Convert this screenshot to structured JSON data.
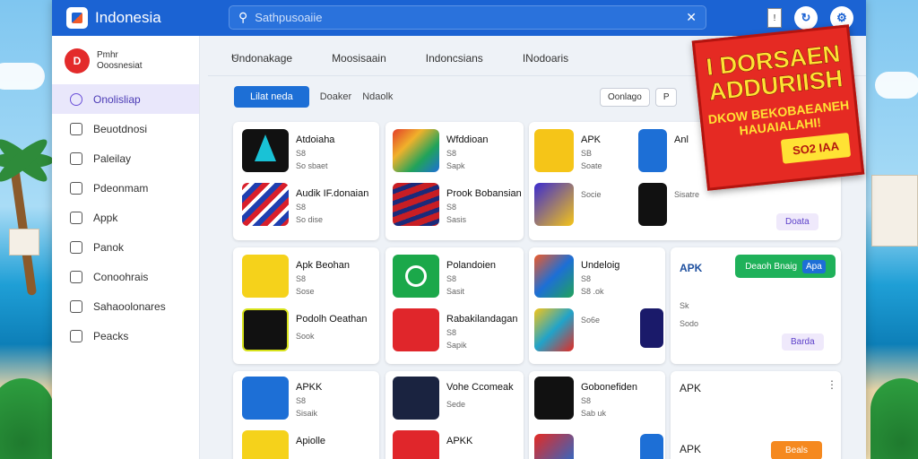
{
  "window": {
    "title": "Indonesia"
  },
  "search": {
    "placeholder": "Sathpusoaiie"
  },
  "sidebar": {
    "profile": {
      "name": "Pmhr",
      "subtitle": "Ooosnesiat"
    },
    "items": [
      {
        "label": "Onolisliap"
      },
      {
        "label": "Beuotdnosi"
      },
      {
        "label": "Paleilay"
      },
      {
        "label": "Pdeonmam"
      },
      {
        "label": "Appk"
      },
      {
        "label": "Panok"
      },
      {
        "label": "Conoohrais"
      },
      {
        "label": "Sahaoolonares"
      },
      {
        "label": "Peacks"
      }
    ]
  },
  "tabs": [
    "Undonakage",
    "Moosisaain",
    "Indoncsians",
    "INodoaris"
  ],
  "filters": {
    "active": "Lilat neda",
    "others": [
      "Doaker",
      "Ndaolk"
    ]
  },
  "sort": [
    "Oonlago",
    "P"
  ],
  "cards": [
    {
      "apps": [
        {
          "name": "Atdoiaha",
          "meta1": "S8",
          "meta2": "So sbaet"
        },
        {
          "name": "Audik IF.donaian",
          "meta1": "S8",
          "meta2": "So dise"
        }
      ]
    },
    {
      "apps": [
        {
          "name": "Wfddioan",
          "meta1": "S8",
          "meta2": "Sapk"
        },
        {
          "name": "Prook Bobansian",
          "meta1": "S8",
          "meta2": "Sasis"
        }
      ]
    },
    {
      "apps": [
        {
          "name": "APK",
          "meta1": "SB",
          "meta2": "Soate"
        },
        {
          "name": "",
          "meta1": "",
          "meta2": "Socie"
        }
      ],
      "extra": {
        "name": "Anl",
        "meta": "Sisatre"
      }
    },
    {
      "apps": [
        {
          "name": "Apk Beohan",
          "meta1": "S8",
          "meta2": "Sose"
        },
        {
          "name": "Podolh Oeathan",
          "meta1": "",
          "meta2": "Sook"
        }
      ]
    },
    {
      "apps": [
        {
          "name": "Polandoien",
          "meta1": "S8",
          "meta2": "Sasit"
        },
        {
          "name": "Rabakilandagan",
          "meta1": "S8",
          "meta2": "Sapik"
        }
      ]
    },
    {
      "apps": [
        {
          "name": "Undeloig",
          "meta1": "S8",
          "meta2": "S8 .ok"
        },
        {
          "name": "",
          "meta1": "",
          "meta2": "So6e"
        }
      ]
    },
    {
      "header": "APK",
      "button": "Deaoh Bnaig",
      "button_secondary": "Apa",
      "sub": "Sk",
      "sub2": "Sodo",
      "action": "Barda"
    },
    {
      "apps": [
        {
          "name": "APKK",
          "meta1": "S8",
          "meta2": "Sisaik"
        },
        {
          "name": "Apiolle",
          "meta1": "",
          "meta2": ""
        }
      ]
    },
    {
      "apps": [
        {
          "name": "Vohe Ccomeak",
          "meta1": "",
          "meta2": "Sede"
        },
        {
          "name": "APKK",
          "meta1": "",
          "meta2": ""
        }
      ]
    },
    {
      "apps": [
        {
          "name": "Gobonefiden",
          "meta1": "S8",
          "meta2": "Sab uk"
        },
        {
          "name": "",
          "meta1": "",
          "meta2": ""
        }
      ]
    },
    {
      "header": "APK",
      "header2": "APK",
      "action": "Beals"
    }
  ],
  "card3_action": "Doata",
  "promo": {
    "title1": "I DORSAEN",
    "title2": "ADDURIISH",
    "subtitle": "DKOW BEKOBAEANEH HAUAIALAHI!",
    "price": "SO2 IAA"
  },
  "colors": {
    "topbar": "#1b63d3",
    "accent": "#1d6fd6",
    "active_nav": "#e9e7fb",
    "promo": "#e52a23"
  }
}
